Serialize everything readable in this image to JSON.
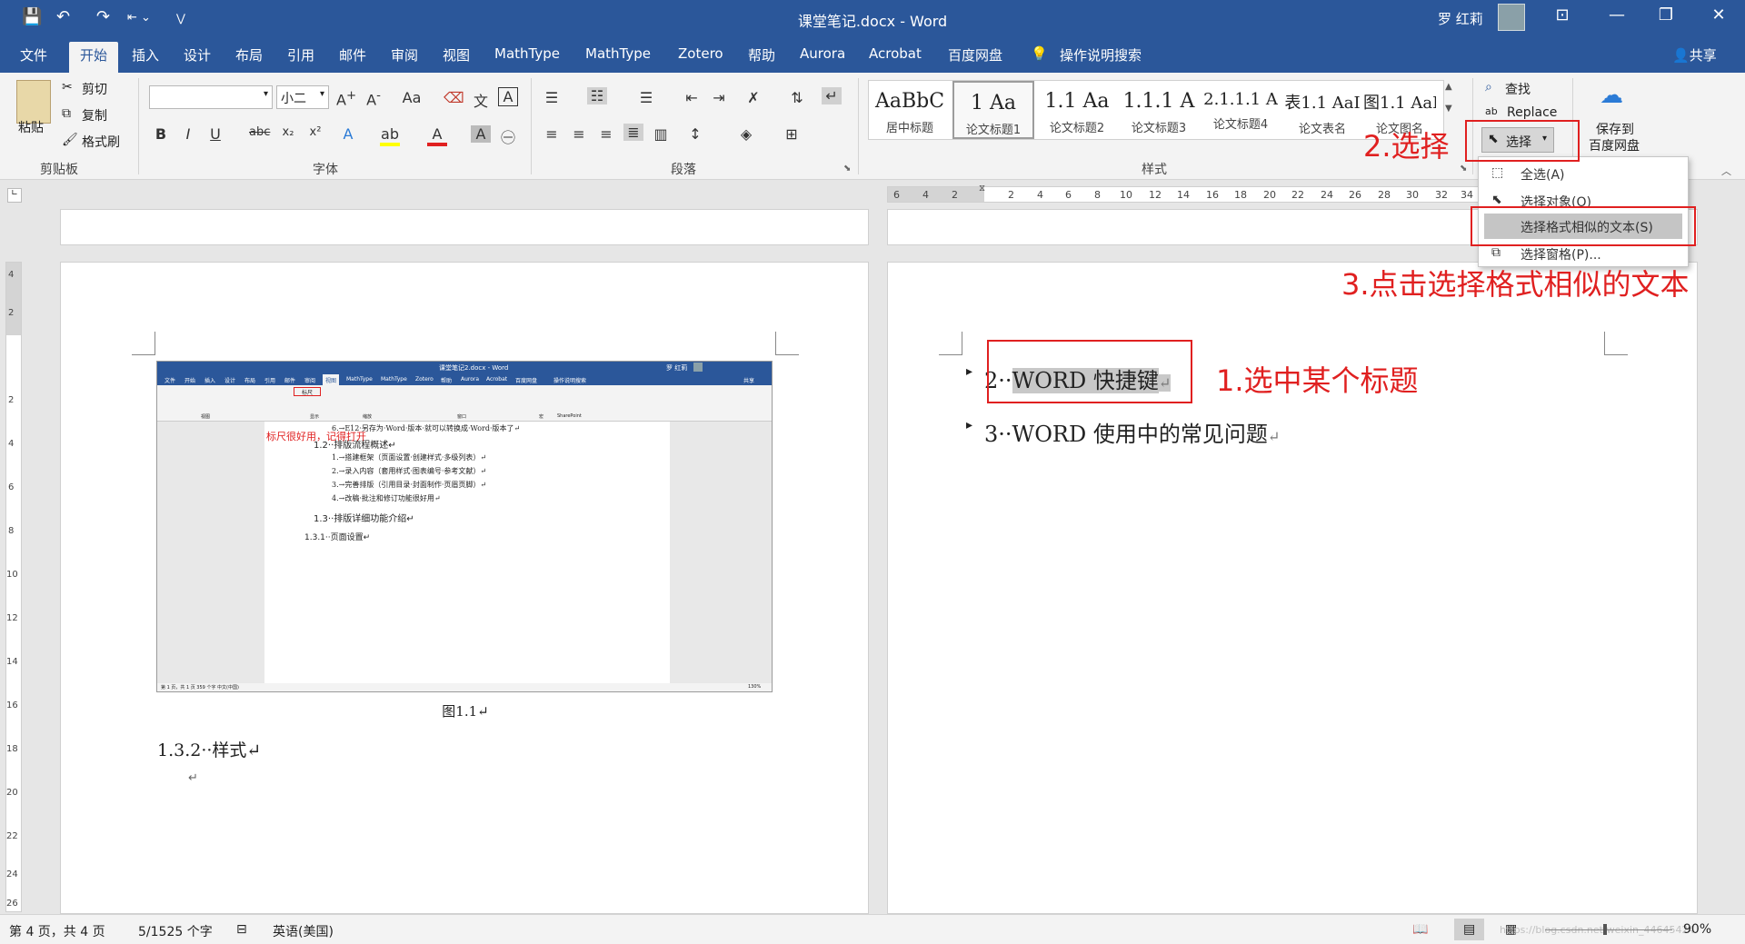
{
  "titlebar": {
    "title": "课堂笔记.docx  -  Word",
    "user": "罗 红莉",
    "qa_save": "💾",
    "qa_undo": "↶",
    "qa_redo": "↷",
    "qa_more": "⋁",
    "win_ribbon": "⊡",
    "win_min": "—",
    "win_max": "❐",
    "win_close": "✕"
  },
  "tabs": {
    "file": "文件",
    "home": "开始",
    "insert": "插入",
    "design": "设计",
    "layout": "布局",
    "references": "引用",
    "mailings": "邮件",
    "review": "审阅",
    "view": "视图",
    "mathtype1": "MathType",
    "mathtype2": "MathType",
    "zotero": "Zotero",
    "help": "帮助",
    "aurora": "Aurora",
    "acrobat": "Acrobat",
    "baidu": "百度网盘",
    "search": "操作说明搜索",
    "share": "共享"
  },
  "ribbon": {
    "clipboard": {
      "paste": "粘贴",
      "cut": "剪切",
      "copy": "复制",
      "format_painter": "格式刷",
      "label": "剪贴板"
    },
    "font": {
      "name": "",
      "size": "小二",
      "label": "字体",
      "case": "Aa"
    },
    "paragraph": {
      "label": "段落"
    },
    "styles": {
      "label": "样式",
      "items": [
        {
          "preview": "AaBbC",
          "name": "居中标题"
        },
        {
          "preview": "1  Aa",
          "name": "论文标题1"
        },
        {
          "preview": "1.1  Aa",
          "name": "论文标题2"
        },
        {
          "preview": "1.1.1  A",
          "name": "论文标题3"
        },
        {
          "preview": "2.1.1.1 A",
          "name": "论文标题4"
        },
        {
          "preview": "表1.1  AaI",
          "name": "论文表名"
        },
        {
          "preview": "图1.1  AaI",
          "name": "论文图名"
        }
      ]
    },
    "editing": {
      "find": "查找",
      "replace": "Replace",
      "select": "选择"
    },
    "save": {
      "line1": "保存到",
      "line2": "百度网盘"
    }
  },
  "ruler": {
    "left_nums": [
      "6",
      "4",
      "2"
    ],
    "right_nums": [
      "2",
      "4",
      "6",
      "8",
      "10",
      "12",
      "14",
      "16",
      "18",
      "20",
      "22",
      "24",
      "26",
      "28",
      "30",
      "32",
      "34"
    ],
    "vertical_nums": [
      "4",
      "2",
      "2",
      "4",
      "6",
      "8",
      "10",
      "12",
      "14",
      "16",
      "18",
      "20",
      "22",
      "24",
      "26"
    ]
  },
  "select_menu": {
    "items": [
      {
        "label": "全选(A)",
        "icon": "⬚"
      },
      {
        "label": "选择对象(O)",
        "icon": "⬉"
      },
      {
        "label": "选择格式相似的文本(S)",
        "icon": ""
      },
      {
        "label": "选择窗格(P)...",
        "icon": "⧉"
      }
    ]
  },
  "annotations": {
    "step1": "1.选中某个标题",
    "step2": "2.选择",
    "step3": "3.点击选择格式相似的文本"
  },
  "left_page": {
    "caption": "图1.1↵",
    "heading": "1.3.2··样式↵",
    "para_mark": "↵"
  },
  "right_page": {
    "heading2_num": "2··",
    "heading2_text": "WORD 快捷键",
    "heading2_mark": "↵",
    "heading3_num": "3··",
    "heading3_text": "WORD 使用中的常见问题",
    "heading3_mark": "↵"
  },
  "embedded": {
    "title": "课堂笔记2.docx - Word",
    "user": "罗 红莉",
    "share": "共享",
    "tabs": [
      "文件",
      "开始",
      "插入",
      "设计",
      "布局",
      "引用",
      "邮件",
      "审阅",
      "视图",
      "MathType",
      "MathType",
      "Zotero",
      "帮助",
      "Aurora",
      "Acrobat",
      "百度网盘",
      "操作说明搜索"
    ],
    "ruler_label": "标尺",
    "ribbon_groups": [
      "视图",
      "显示",
      "缩放",
      "窗口",
      "宏",
      "SharePoint"
    ],
    "ruler_note": "标尺很好用，记得打开",
    "lines": [
      "6.→E12·另存为·Word·版本·就可以转换成·Word·版本了↵",
      "1.2··排版流程概述↵",
      "1.→搭建框架（页面设置·创建样式·多级列表）↵",
      "2.→录入内容（套用样式·图表编号·参考文献）↵",
      "3.→完善排版（引用目录·封面制作·页眉页脚）↵",
      "4.→改稿·批注和修订功能很好用↵",
      "1.3··排版详细功能介绍↵",
      "1.3.1··页面设置↵"
    ],
    "status": "第 1 页，共 1 页    359 个字    中文(中国)",
    "zoom": "130%"
  },
  "statusbar": {
    "page": "第 4 页，共 4 页",
    "words": "5/1525 个字",
    "lang": "英语(美国)",
    "zoom": "90%",
    "watermark": "https://blog.csdn.net/weixin_44645424"
  }
}
